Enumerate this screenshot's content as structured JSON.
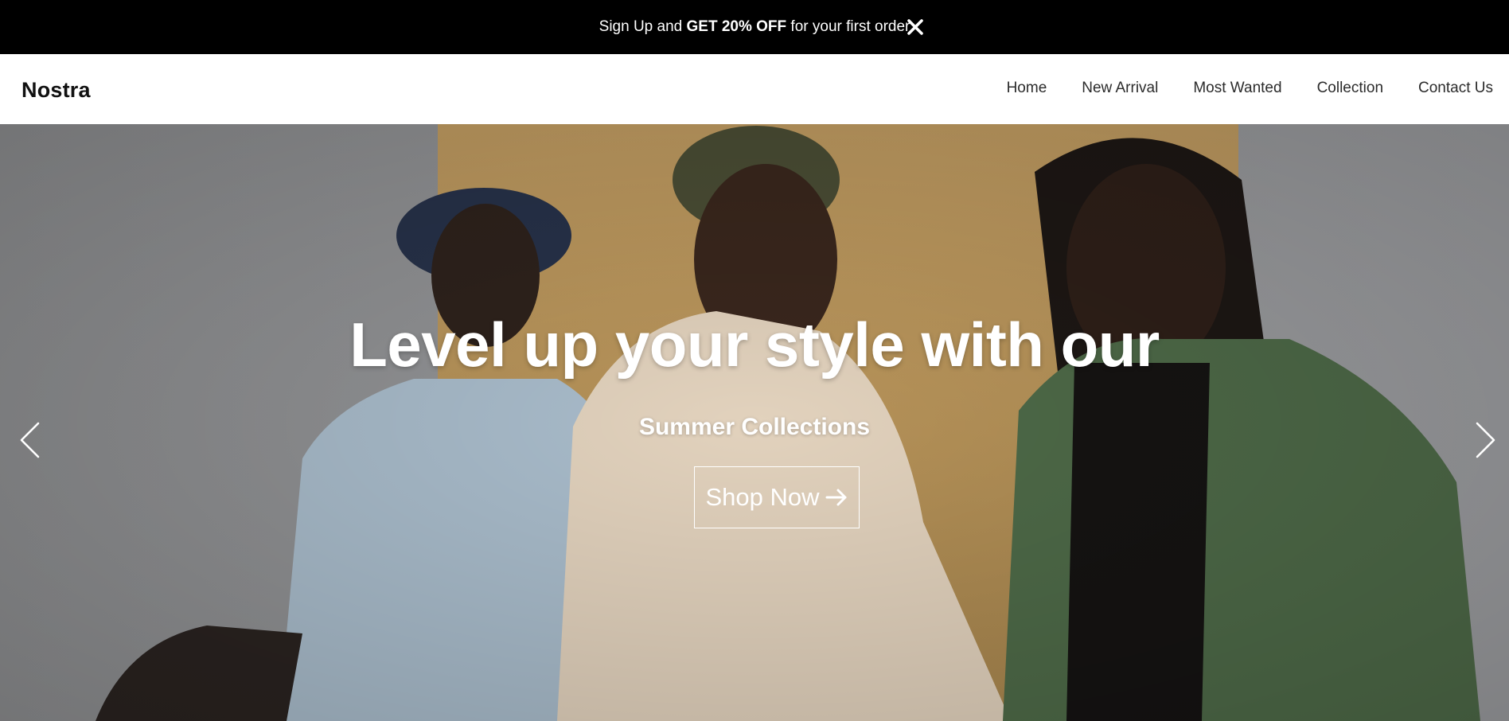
{
  "promo": {
    "text_before": "Sign Up and ",
    "text_bold": "GET 20% OFF",
    "text_after": " for your first order",
    "close_icon": "close-icon"
  },
  "header": {
    "brand": "Nostra",
    "nav": [
      {
        "label": "Home"
      },
      {
        "label": "New Arrival"
      },
      {
        "label": "Most Wanted"
      },
      {
        "label": "Collection"
      },
      {
        "label": "Contact Us"
      }
    ]
  },
  "hero": {
    "title": "Level up your style with our",
    "subtitle": "Summer Collections",
    "cta_label": "Shop Now",
    "cta_icon": "arrow-right-icon",
    "prev_icon": "chevron-left-icon",
    "next_icon": "chevron-right-icon"
  },
  "colors": {
    "promo_bg": "#000000",
    "text_on_dark": "#ffffff",
    "nav_text": "#2b2b2b"
  }
}
